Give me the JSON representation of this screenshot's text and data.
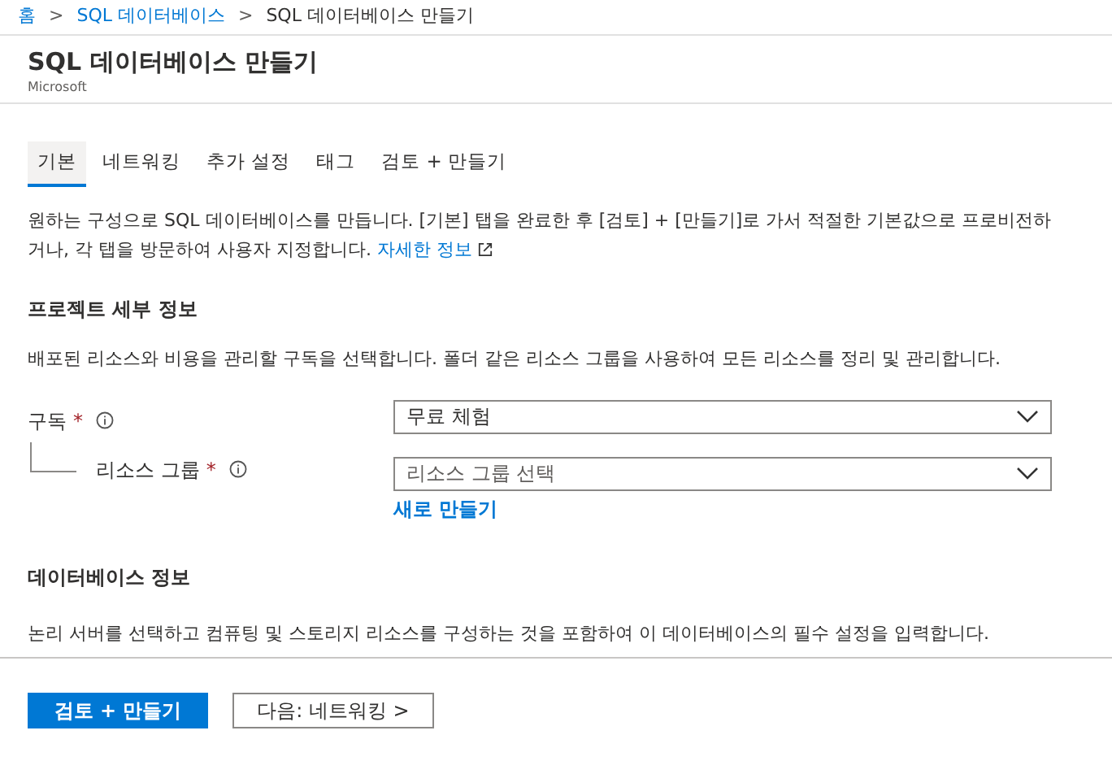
{
  "breadcrumb": [
    {
      "label": "홈",
      "link": true
    },
    {
      "label": "SQL 데이터베이스",
      "link": true
    },
    {
      "label": "SQL 데이터베이스 만들기",
      "link": false
    }
  ],
  "breadcrumb_separator": ">",
  "required_mark": "*",
  "page": {
    "title": "SQL 데이터베이스 만들기",
    "subtitle": "Microsoft"
  },
  "tabs": [
    {
      "label": "기본",
      "selected": true
    },
    {
      "label": "네트워킹",
      "selected": false
    },
    {
      "label": "추가 설정",
      "selected": false
    },
    {
      "label": "태그",
      "selected": false
    },
    {
      "label": "검토 + 만들기",
      "selected": false
    }
  ],
  "intro": {
    "text": "원하는 구성으로 SQL 데이터베이스를 만듭니다. [기본] 탭을 완료한 후 [검토] + [만들기]로 가서 적절한 기본값으로 프로비전하거나, 각 탭을 방문하여 사용자 지정합니다.",
    "link": "자세한 정보"
  },
  "project_details": {
    "heading": "프로젝트 세부 정보",
    "description": "배포된 리소스와 비용을 관리할 구독을 선택합니다. 폴더 같은 리소스 그룹을 사용하여 모든 리소스를 정리 및 관리합니다.",
    "fields": [
      {
        "label": "구독",
        "required": true,
        "value": "무료 체험"
      },
      {
        "label": "리소스 그룹",
        "required": true,
        "placeholder": "리소스 그룹 선택",
        "link": "새로 만들기"
      }
    ]
  },
  "database_details": {
    "heading": "데이터베이스 정보",
    "description": "논리 서버를 선택하고 컴퓨팅 및 스토리지 리소스를 구성하는 것을 포함하여 이 데이터베이스의 필수 설정을 입력합니다."
  },
  "footer_buttons": [
    {
      "label": "검토 + 만들기",
      "kind": "primary"
    },
    {
      "label": "다음: 네트워킹 >",
      "kind": "secondary"
    }
  ]
}
